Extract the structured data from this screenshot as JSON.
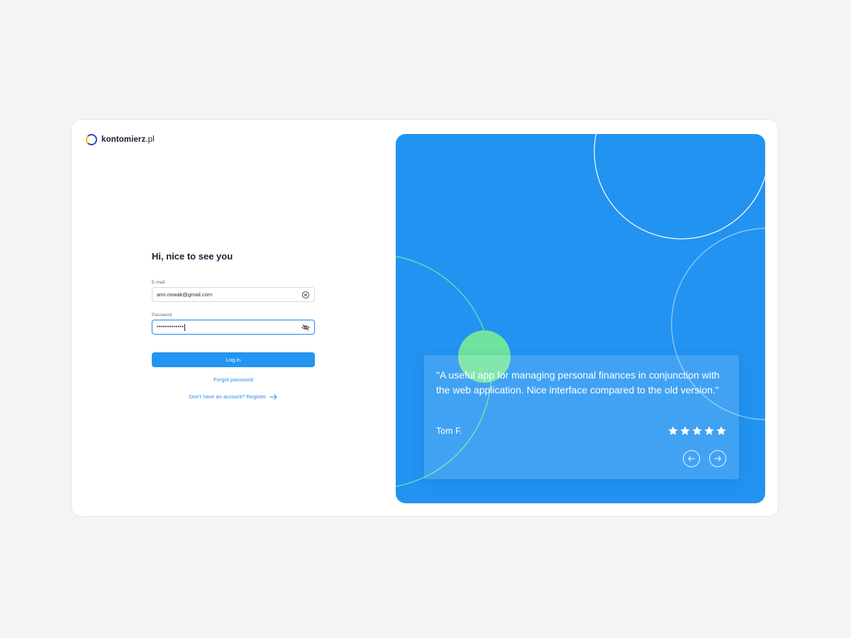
{
  "brand": {
    "name_bold": "kontomierz",
    "name_light": ".pl"
  },
  "form": {
    "greeting": "Hi, nice to see you",
    "email_label": "E-mail",
    "email_value": "ann.nowak@gmail.com",
    "password_label": "Password",
    "password_masked": "•••••••••••••",
    "login_label": "Log in",
    "forgot_label": "Forgot password",
    "register_label": "Don't have an account? Register"
  },
  "testimonial": {
    "quote": "\"A useful app for managing personal finances in conjunction with the web application. Nice interface compared to the old version.\"",
    "author": "Tom F.",
    "rating": 5,
    "rating_max": 5
  },
  "icons": {
    "email_clear": "clear-circle-icon",
    "password_toggle": "eye-off-icon",
    "register_arrow": "arrow-right-icon",
    "prev": "arrow-left-icon",
    "next": "arrow-right-icon",
    "star": "star-icon"
  },
  "colors": {
    "accent": "#2495f0",
    "panel": "#2293f1",
    "link": "#2d8ce8",
    "green": "#6fe3a0",
    "text_dark": "#1b2033",
    "page_bg": "#f4f4f4"
  }
}
